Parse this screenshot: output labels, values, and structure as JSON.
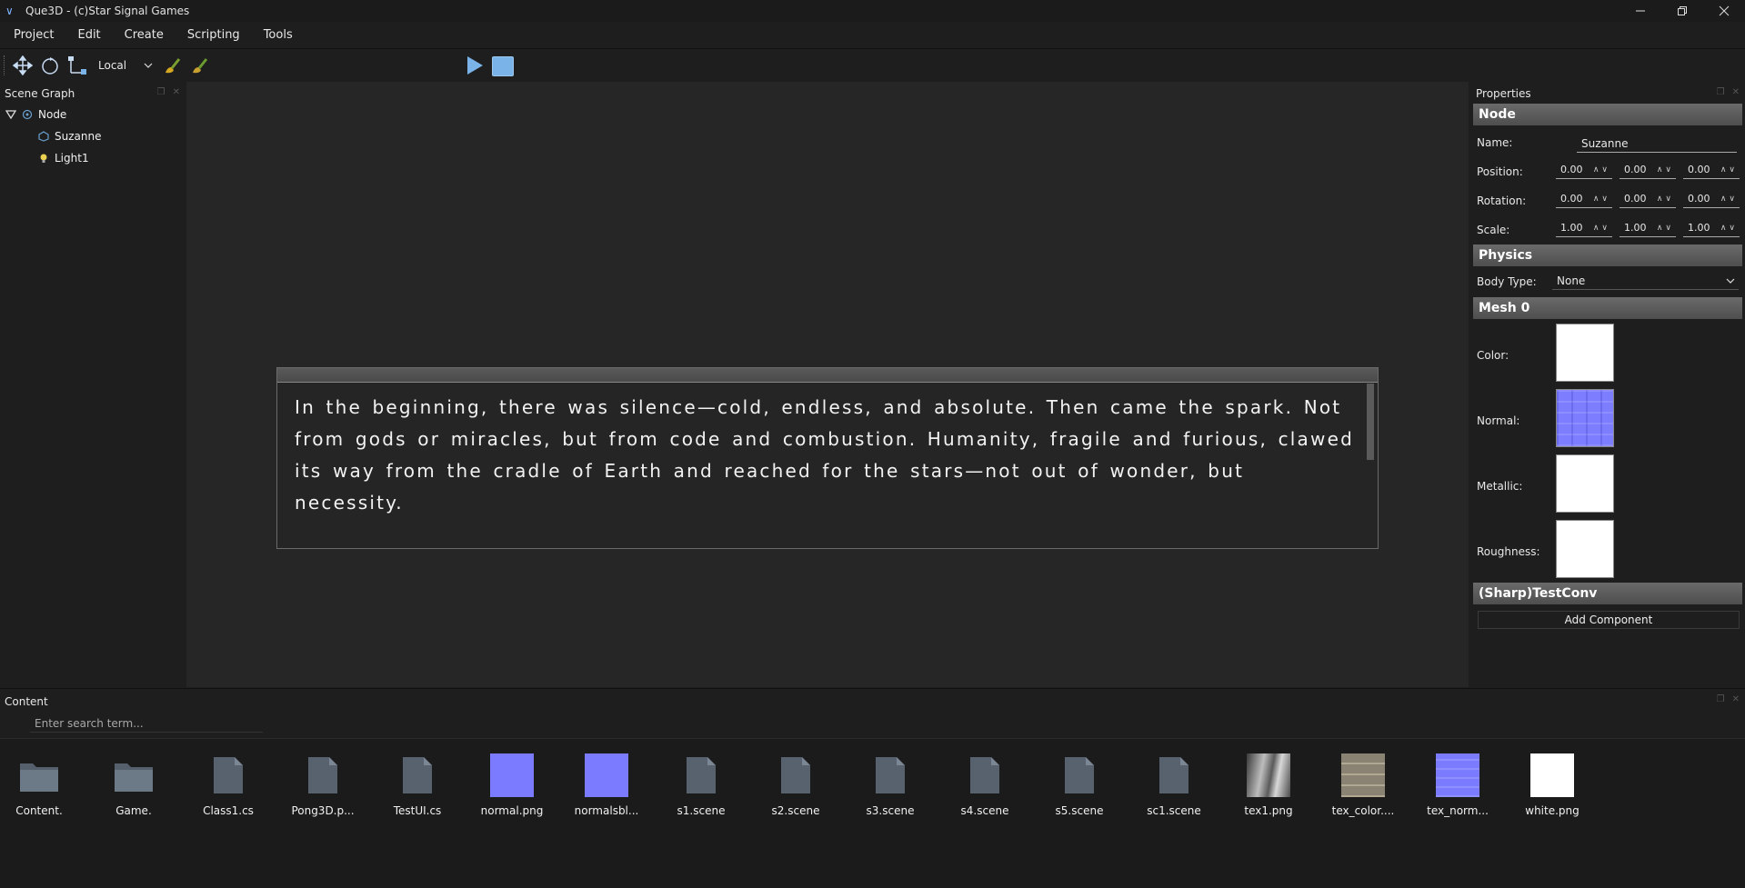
{
  "window": {
    "title": "Que3D - (c)Star Signal Games",
    "controls": [
      "minimize",
      "restore",
      "close"
    ]
  },
  "menu": [
    "Project",
    "Edit",
    "Create",
    "Scripting",
    "Tools"
  ],
  "toolbar": {
    "space": "Local",
    "tools": [
      "move-icon",
      "rotate-icon",
      "scale-icon",
      "brush-icon",
      "brush-alt-icon",
      "play-icon",
      "stop-icon"
    ]
  },
  "scene_graph": {
    "title": "Scene Graph",
    "nodes": [
      {
        "label": "Node",
        "level": 0,
        "icon": "node-icon"
      },
      {
        "label": "Suzanne",
        "level": 1,
        "icon": "mesh-icon"
      },
      {
        "label": "Light1",
        "level": 1,
        "icon": "light-icon"
      }
    ]
  },
  "viewport": {
    "text": "In the beginning, there was silence—cold, endless, and absolute. Then came the spark. Not from gods or miracles, but from code and combustion. Humanity, fragile and furious, clawed its way from the cradle of Earth and reached for the stars—not out of wonder, but necessity."
  },
  "properties": {
    "title": "Properties",
    "node_section": "Node",
    "name_label": "Name:",
    "name_value": "Suzanne",
    "position_label": "Position:",
    "position": [
      "0.00",
      "0.00",
      "0.00"
    ],
    "rotation_label": "Rotation:",
    "rotation": [
      "0.00",
      "0.00",
      "0.00"
    ],
    "scale_label": "Scale:",
    "scale": [
      "1.00",
      "1.00",
      "1.00"
    ],
    "physics_section": "Physics",
    "body_type_label": "Body Type:",
    "body_type": "None",
    "mesh_section": "Mesh 0",
    "color_label": "Color:",
    "normal_label": "Normal:",
    "metallic_label": "Metallic:",
    "roughness_label": "Roughness:",
    "script_section": "(Sharp)TestConv",
    "add_component": "Add Component"
  },
  "content": {
    "title": "Content",
    "search_placeholder": "Enter search term...",
    "assets": [
      {
        "label": "Content.",
        "kind": "folder"
      },
      {
        "label": "Game.",
        "kind": "folder"
      },
      {
        "label": "Class1.cs",
        "kind": "file"
      },
      {
        "label": "Pong3D.p...",
        "kind": "file"
      },
      {
        "label": "TestUI.cs",
        "kind": "file"
      },
      {
        "label": "normal.png",
        "kind": "image",
        "color": "#7b7bff"
      },
      {
        "label": "normalsbl...",
        "kind": "image",
        "color": "#7b7bff"
      },
      {
        "label": "s1.scene",
        "kind": "file"
      },
      {
        "label": "s2.scene",
        "kind": "file"
      },
      {
        "label": "s3.scene",
        "kind": "file"
      },
      {
        "label": "s4.scene",
        "kind": "file"
      },
      {
        "label": "s5.scene",
        "kind": "file"
      },
      {
        "label": "sc1.scene",
        "kind": "file"
      },
      {
        "label": "tex1.png",
        "kind": "image",
        "color": "#9a9a9a"
      },
      {
        "label": "tex_color....",
        "kind": "image",
        "color": "#8a8272"
      },
      {
        "label": "tex_norm...",
        "kind": "image",
        "color": "#7b7bff"
      },
      {
        "label": "white.png",
        "kind": "image",
        "color": "#ffffff"
      }
    ]
  },
  "colors": {
    "background": "#1e1e1e",
    "viewport": "#262626",
    "accent": "#7ab3e8",
    "section_header": "#5a5a5a"
  }
}
